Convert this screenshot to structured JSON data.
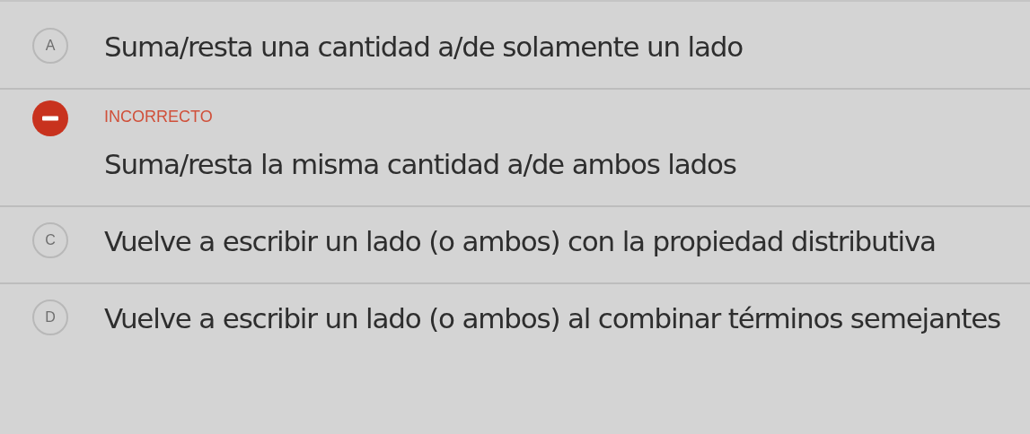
{
  "options": [
    {
      "letter": "A",
      "selected": false,
      "text": "Suma/resta una cantidad a/de solamente un lado"
    },
    {
      "selected": true,
      "feedback": "INCORRECTO",
      "text": "Suma/resta la misma cantidad a/de ambos lados"
    },
    {
      "letter": "C",
      "selected": false,
      "text": "Vuelve a escribir un lado (o ambos) con la propiedad distributiva"
    },
    {
      "letter": "D",
      "selected": false,
      "text": "Vuelve a escribir un lado (o ambos) al combinar términos semejantes"
    }
  ]
}
